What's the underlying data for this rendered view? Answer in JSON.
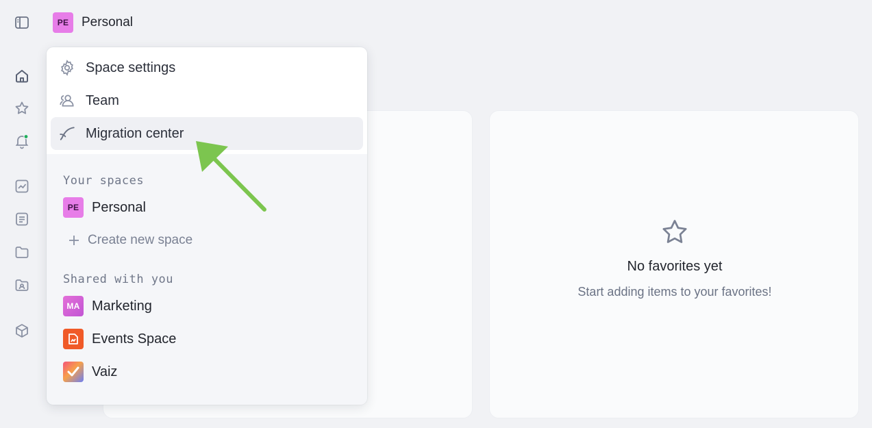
{
  "header": {
    "space_badge": "PE",
    "space_name": "Personal"
  },
  "rail": {
    "icons": [
      "sidebar-toggle-icon",
      "home-icon",
      "star-icon",
      "bell-icon",
      "chart-icon",
      "document-icon",
      "folder-icon",
      "shared-folder-icon",
      "cube-icon"
    ],
    "notification_dot_color": "#1fae5b"
  },
  "dropdown": {
    "menu": [
      {
        "label": "Space settings",
        "icon": "gear-icon"
      },
      {
        "label": "Team",
        "icon": "team-icon"
      },
      {
        "label": "Migration center",
        "icon": "migration-icon",
        "active": true
      }
    ],
    "your_spaces_title": "Your spaces",
    "your_spaces": [
      {
        "badge": "PE",
        "label": "Personal"
      }
    ],
    "create_label": "Create new space",
    "shared_title": "Shared with you",
    "shared": [
      {
        "badge": "MA",
        "label": "Marketing"
      },
      {
        "badge": "",
        "label": "Events Space"
      },
      {
        "badge": "",
        "label": "Vaiz"
      }
    ]
  },
  "favorites": {
    "title": "No favorites yet",
    "subtitle": "Start adding items to your favorites!"
  },
  "colors": {
    "background": "#f1f2f5",
    "accent_arrow": "#7cc54f",
    "personal_badge": "#e77de8"
  }
}
